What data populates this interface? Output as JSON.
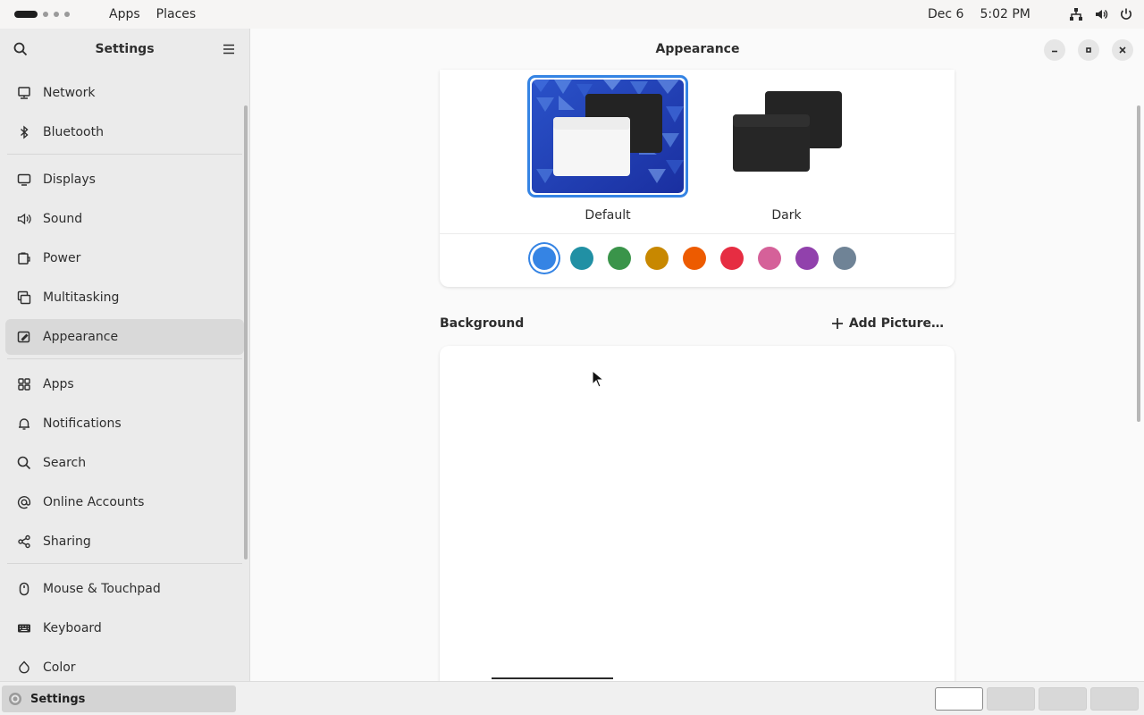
{
  "topbar": {
    "menus": [
      "Apps",
      "Places"
    ],
    "date": "Dec 6",
    "time": "5:02 PM"
  },
  "sidebar": {
    "title": "Settings",
    "groups": [
      [
        {
          "label": "Network",
          "icon": "network-icon"
        },
        {
          "label": "Bluetooth",
          "icon": "bluetooth-icon"
        }
      ],
      [
        {
          "label": "Displays",
          "icon": "display-icon"
        },
        {
          "label": "Sound",
          "icon": "sound-icon"
        },
        {
          "label": "Power",
          "icon": "power-icon"
        },
        {
          "label": "Multitasking",
          "icon": "multitasking-icon"
        },
        {
          "label": "Appearance",
          "icon": "appearance-icon",
          "active": true
        }
      ],
      [
        {
          "label": "Apps",
          "icon": "apps-grid-icon"
        },
        {
          "label": "Notifications",
          "icon": "bell-icon"
        },
        {
          "label": "Search",
          "icon": "search-icon"
        },
        {
          "label": "Online Accounts",
          "icon": "at-icon"
        },
        {
          "label": "Sharing",
          "icon": "share-icon"
        }
      ],
      [
        {
          "label": "Mouse & Touchpad",
          "icon": "mouse-icon"
        },
        {
          "label": "Keyboard",
          "icon": "keyboard-icon"
        },
        {
          "label": "Color",
          "icon": "color-icon"
        }
      ]
    ]
  },
  "main": {
    "title": "Appearance",
    "styles": [
      {
        "label": "Default",
        "selected": true
      },
      {
        "label": "Dark",
        "selected": false
      }
    ],
    "accent_colors": [
      "#3584e4",
      "#2190a4",
      "#3a944a",
      "#c88800",
      "#ed5b00",
      "#e62d42",
      "#d56199",
      "#9141ac",
      "#6f8396"
    ],
    "selected_accent": "#3584e4",
    "background": {
      "title": "Background",
      "add_label": "Add Picture…"
    }
  },
  "taskbar": {
    "window_label": "Settings",
    "workspaces": 4
  }
}
